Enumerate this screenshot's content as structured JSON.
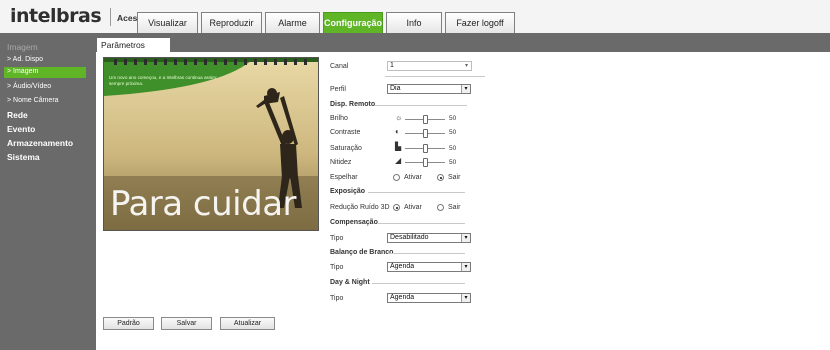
{
  "header": {
    "logo": "intelbras",
    "subtitle": "Acesso Web",
    "tabs": [
      {
        "label": "Visualizar"
      },
      {
        "label": "Reproduzir"
      },
      {
        "label": "Alarme"
      },
      {
        "label": "Configuração"
      },
      {
        "label": "Info"
      },
      {
        "label": "Fazer logoff"
      }
    ]
  },
  "sidebar": {
    "imagem_header": "Imagem",
    "items": [
      {
        "label": "> Ad. Dispo"
      },
      {
        "label": "> Imagem"
      },
      {
        "label": "> Áudio/Vídeo"
      },
      {
        "label": "> Nome Câmera"
      }
    ],
    "categories": [
      {
        "label": "Rede"
      },
      {
        "label": "Evento"
      },
      {
        "label": "Armazenamento"
      },
      {
        "label": "Sistema"
      }
    ]
  },
  "panel": {
    "tab_label": "Parâmetros"
  },
  "preview": {
    "overlay_small": "Um novo ano começou, e a Intelbras continua assim: sempre próxima.",
    "overlay_big": "Para cuidar"
  },
  "settings": {
    "canal": {
      "label": "Canal",
      "value": "1"
    },
    "perfil": {
      "label": "Perfil",
      "value": "Dia"
    },
    "disp_remoto": "Disp. Remoto",
    "brilho": {
      "label": "Brilho",
      "value": "50",
      "level": 0.5
    },
    "contraste": {
      "label": "Contraste",
      "value": "50",
      "level": 0.5
    },
    "saturacao": {
      "label": "Saturação",
      "value": "50",
      "level": 0.5
    },
    "nitidez": {
      "label": "Nitidez",
      "value": "50",
      "level": 0.5
    },
    "espelhar": {
      "label": "Espelhar",
      "opt_on": "Ativar",
      "opt_off": "Sair",
      "selected": "Sair"
    },
    "exposicao": "Exposição",
    "reducao": {
      "label": "Redução Ruído 3D",
      "opt_on": "Ativar",
      "opt_off": "Sair",
      "selected": "Ativar"
    },
    "compensacao": "Compensação",
    "comp_tipo": {
      "label": "Tipo",
      "value": "Desabilitado"
    },
    "balanco": "Balanço de Branco",
    "bal_tipo": {
      "label": "Tipo",
      "value": "Agenda"
    },
    "daynight": "Day & Night",
    "dn_tipo": {
      "label": "Tipo",
      "value": "Agenda"
    }
  },
  "buttons": {
    "padrao": "Padrão",
    "salvar": "Salvar",
    "atualizar": "Atualizar"
  },
  "colors": {
    "accent_green": "#5fb526",
    "sidebar_gray": "#6a6a6a"
  }
}
